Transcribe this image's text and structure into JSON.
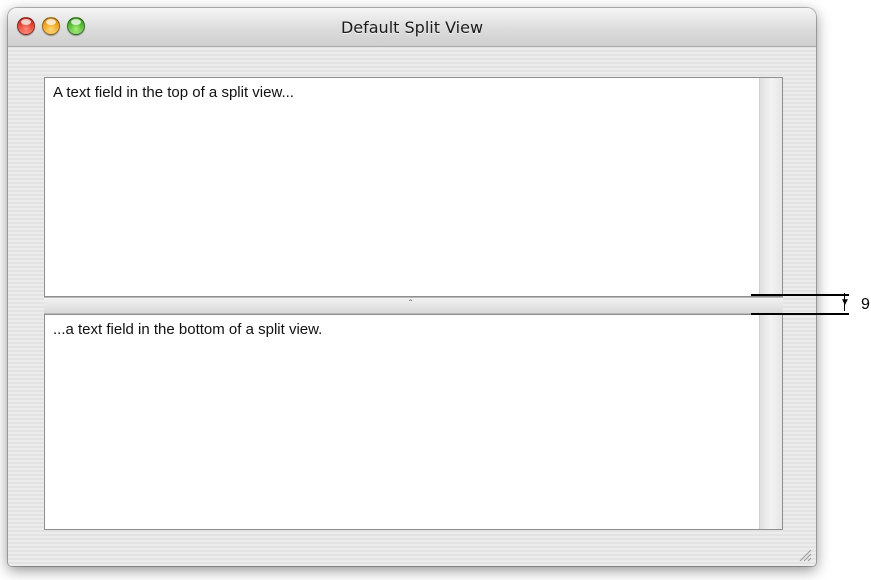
{
  "window": {
    "title": "Default Split View"
  },
  "split_view": {
    "top_pane_text": "A text field in the top of a split view...",
    "bottom_pane_text": "...a text field in the bottom of a split view.",
    "divider_glyph": "ˆ"
  },
  "annotation": {
    "label": "9",
    "arrow_glyph": "▼"
  },
  "icons": {
    "close": "close-icon",
    "minimize": "minimize-icon",
    "zoom": "zoom-icon",
    "resize": "resize-grip-icon",
    "divider": "divider-dimple-icon"
  },
  "colors": {
    "close": "#e23d2a",
    "minimize": "#f0a11a",
    "zoom": "#4cb62a"
  }
}
